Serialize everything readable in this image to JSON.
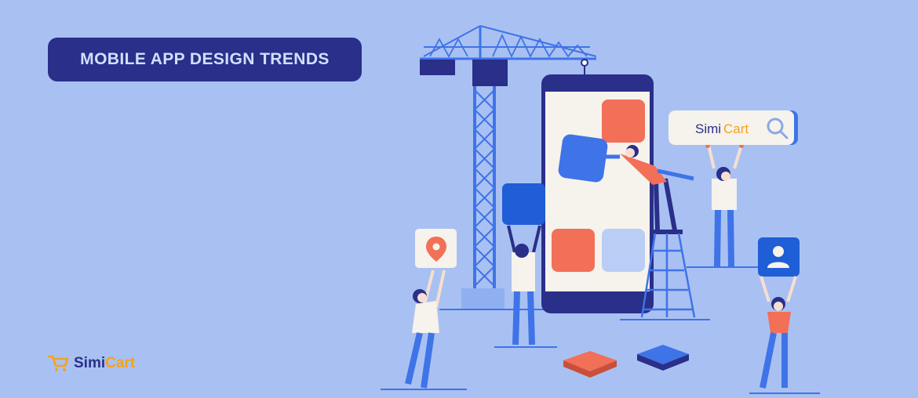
{
  "banner": {
    "title": "MOBILE APP DESIGN TRENDS"
  },
  "brand": {
    "name_part1": "Simi",
    "name_part2": "Cart",
    "search_name_part1": "Simi",
    "search_name_part2": "Cart"
  },
  "colors": {
    "background": "#a9c1f2",
    "navy": "#2a2f8a",
    "blue": "#3f73e8",
    "coral": "#f26f58",
    "orange": "#f5a21b"
  },
  "icons": [
    "cart-logo-icon",
    "search-icon",
    "location-pin-icon",
    "user-icon"
  ]
}
